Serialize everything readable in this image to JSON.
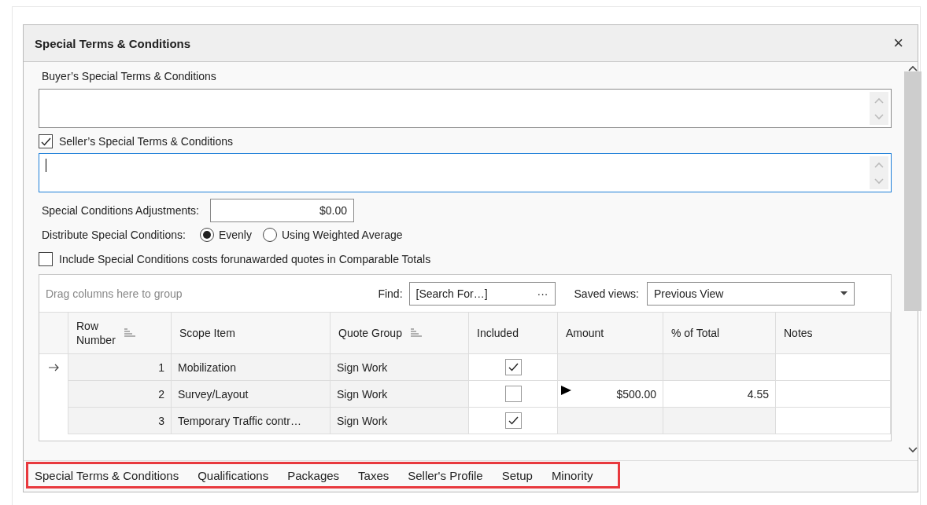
{
  "window": {
    "title": "Special Terms & Conditions",
    "close": "×"
  },
  "buyer": {
    "label": "Buyer’s Special Terms & Conditions",
    "focused": false
  },
  "seller": {
    "label": "Seller’s Special Terms & Conditions",
    "checked": true,
    "focused": true
  },
  "adjustments": {
    "label": "Special Conditions Adjustments:",
    "value": "$0.00"
  },
  "distribute": {
    "label": "Distribute Special Conditions:",
    "options": [
      {
        "label": "Evenly",
        "selected": true
      },
      {
        "label": "Using Weighted Average",
        "selected": false
      }
    ]
  },
  "include_unawarded": {
    "label": "Include Special Conditions costs forunawarded quotes in Comparable Totals",
    "checked": false
  },
  "grid": {
    "group_hint": "Drag columns here to group",
    "find_label": "Find:",
    "find_placeholder": "[Search For…]",
    "find_button": "···",
    "views_label": "Saved views:",
    "views_value": "Previous View",
    "columns": [
      {
        "label": "Row\nNumber",
        "sortable": true
      },
      {
        "label": "Scope Item",
        "sortable": false
      },
      {
        "label": "Quote Group",
        "sortable": true
      },
      {
        "label": "Included",
        "sortable": false
      },
      {
        "label": "Amount",
        "sortable": false
      },
      {
        "label": "% of Total",
        "sortable": false
      },
      {
        "label": "Notes",
        "sortable": false
      }
    ],
    "rows": [
      {
        "current": true,
        "row_number": "1",
        "scope_item": "Mobilization",
        "quote_group": "Sign Work",
        "included": true,
        "editing": false,
        "amount": "",
        "percent": "",
        "notes": ""
      },
      {
        "current": false,
        "row_number": "2",
        "scope_item": "Survey/Layout",
        "quote_group": "Sign Work",
        "included": false,
        "editing": true,
        "amount": "$500.00",
        "percent": "4.55",
        "notes": ""
      },
      {
        "current": false,
        "row_number": "3",
        "scope_item": "Temporary Traffic contr…",
        "quote_group": "Sign Work",
        "included": true,
        "editing": false,
        "amount": "",
        "percent": "",
        "notes": ""
      }
    ]
  },
  "tabs": [
    "Special Terms & Conditions",
    "Qualifications",
    "Packages",
    "Taxes",
    "Seller's Profile",
    "Setup",
    "Minority"
  ]
}
